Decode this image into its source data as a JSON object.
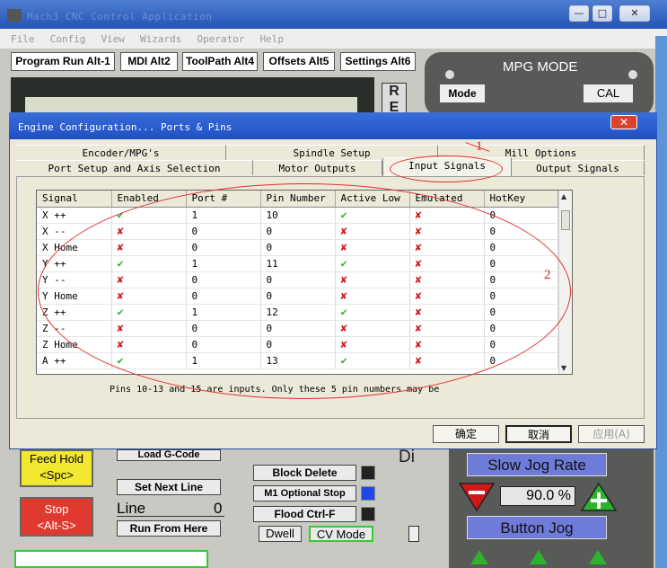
{
  "window": {
    "title": "Mach3 CNC Control Application",
    "min": "—",
    "max": "□",
    "close": "✕"
  },
  "menu": [
    "File",
    "Config",
    "View",
    "Wizards",
    "Operator",
    "Help"
  ],
  "toolbar_tabs": [
    "Program Run Alt-1",
    "MDI Alt2",
    "ToolPath Alt4",
    "Offsets Alt5",
    "Settings Alt6"
  ],
  "mpg": {
    "title": "MPG MODE",
    "mode": "Mode",
    "cal": "CAL"
  },
  "ref_letters": "R\nE",
  "dialog": {
    "title": "Engine Configuration... Ports & Pins",
    "close": "✕",
    "tabs_row1": [
      "Encoder/MPG's",
      "Spindle Setup",
      "Mill Options"
    ],
    "tabs_row2": [
      "Port Setup and Axis Selection",
      "Motor Outputs",
      "Input Signals",
      "Output Signals"
    ],
    "columns": [
      "Signal",
      "Enabled",
      "Port #",
      "Pin Number",
      "Active Low",
      "Emulated",
      "HotKey"
    ],
    "rows": [
      {
        "signal": "X ++",
        "enabled": "✔",
        "enabled_ok": true,
        "port": "1",
        "pin": "10",
        "active_low": "✔",
        "active_ok": true,
        "emulated": "✘",
        "hotkey": "0"
      },
      {
        "signal": "X --",
        "enabled": "✘",
        "enabled_ok": false,
        "port": "0",
        "pin": "0",
        "active_low": "✘",
        "active_ok": false,
        "emulated": "✘",
        "hotkey": "0"
      },
      {
        "signal": "X Home",
        "enabled": "✘",
        "enabled_ok": false,
        "port": "0",
        "pin": "0",
        "active_low": "✘",
        "active_ok": false,
        "emulated": "✘",
        "hotkey": "0"
      },
      {
        "signal": "Y ++",
        "enabled": "✔",
        "enabled_ok": true,
        "port": "1",
        "pin": "11",
        "active_low": "✔",
        "active_ok": true,
        "emulated": "✘",
        "hotkey": "0"
      },
      {
        "signal": "Y --",
        "enabled": "✘",
        "enabled_ok": false,
        "port": "0",
        "pin": "0",
        "active_low": "✘",
        "active_ok": false,
        "emulated": "✘",
        "hotkey": "0"
      },
      {
        "signal": "Y Home",
        "enabled": "✘",
        "enabled_ok": false,
        "port": "0",
        "pin": "0",
        "active_low": "✘",
        "active_ok": false,
        "emulated": "✘",
        "hotkey": "0"
      },
      {
        "signal": "Z ++",
        "enabled": "✔",
        "enabled_ok": true,
        "port": "1",
        "pin": "12",
        "active_low": "✔",
        "active_ok": true,
        "emulated": "✘",
        "hotkey": "0"
      },
      {
        "signal": "Z --",
        "enabled": "✘",
        "enabled_ok": false,
        "port": "0",
        "pin": "0",
        "active_low": "✘",
        "active_ok": false,
        "emulated": "✘",
        "hotkey": "0"
      },
      {
        "signal": "Z Home",
        "enabled": "✘",
        "enabled_ok": false,
        "port": "0",
        "pin": "0",
        "active_low": "✘",
        "active_ok": false,
        "emulated": "✘",
        "hotkey": "0"
      },
      {
        "signal": "A ++",
        "enabled": "✔",
        "enabled_ok": true,
        "port": "1",
        "pin": "13",
        "active_low": "✔",
        "active_ok": true,
        "emulated": "✘",
        "hotkey": "0"
      }
    ],
    "note": "Pins 10-13 and 15 are inputs. Only these 5 pin numbers may be",
    "ok": "确定",
    "cancel": "取消",
    "apply": "应用(A)"
  },
  "annotations": {
    "a1": "1",
    "a2": "2"
  },
  "controls": {
    "feed_hold": "Feed Hold\n<Spc>",
    "stop": "Stop\n<Alt-S>",
    "load_gcode": "Load G-Code",
    "set_next_line": "Set Next Line",
    "line_label": "Line",
    "line_value": "0",
    "run_from_here": "Run From Here",
    "block_delete": "Block Delete",
    "m1_optional_stop": "M1 Optional Stop",
    "flood": "Flood Ctrl-F",
    "dwell": "Dwell",
    "cv_mode": "CV Mode",
    "di": "Di",
    "slow_jog_rate": "Slow Jog Rate",
    "jog_value": "90.0",
    "jog_unit": "%",
    "button_jog": "Button Jog"
  }
}
